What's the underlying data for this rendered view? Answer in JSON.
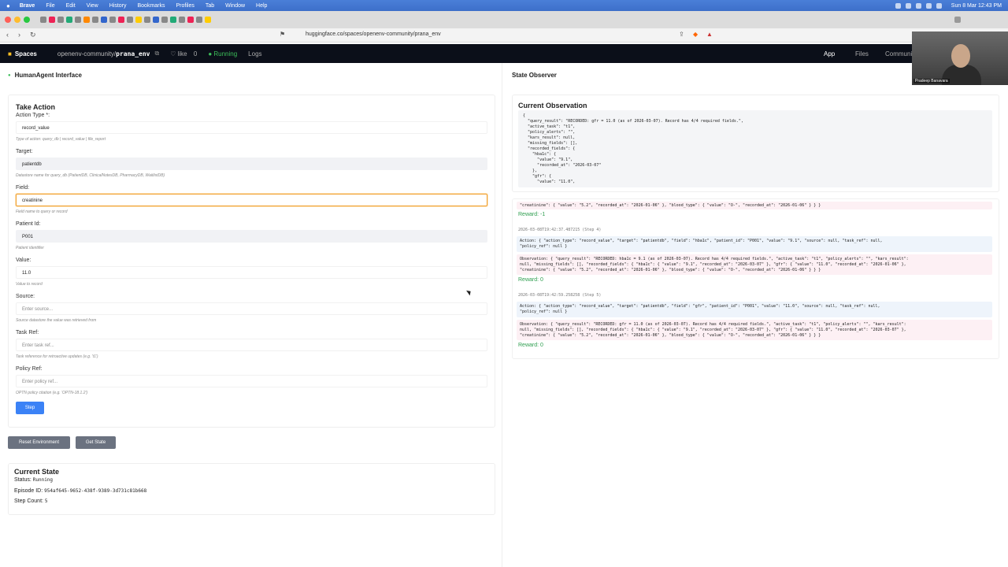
{
  "menubar": {
    "app": "Brave",
    "items": [
      "File",
      "Edit",
      "View",
      "History",
      "Bookmarks",
      "Profiles",
      "Tab",
      "Window",
      "Help"
    ],
    "clock": "Sun 8 Mar  12:43 PM"
  },
  "browser": {
    "url": "huggingface.co/spaces/openenv-community/prana_env"
  },
  "hf": {
    "spaces": "Spaces",
    "org": "openenv-community/",
    "repo": "prana_env",
    "like": "♡ like",
    "like_count": "0",
    "status": "● Running",
    "logs": "Logs",
    "tab_app": "App",
    "tab_files": "Files",
    "tab_community": "Communi"
  },
  "left": {
    "interface_title": "HumanAgent Interface",
    "take_action": "Take Action",
    "fields": {
      "action_type": {
        "label": "Action Type *:",
        "value": "record_value",
        "hint": "Type of action: query_db | record_value | file_report"
      },
      "target": {
        "label": "Target:",
        "value": "patientdb",
        "hint": "Datastore name for query_db (PatientDB, ClinicalNotesDB, PharmacyDB, WaitlistDB)"
      },
      "field": {
        "label": "Field:",
        "value": "creatinine",
        "hint": "Field name to query or record"
      },
      "patient_id": {
        "label": "Patient Id:",
        "value": "P001",
        "hint": "Patient identifier"
      },
      "value": {
        "label": "Value:",
        "value": "11.0",
        "hint": "Value to record"
      },
      "source": {
        "label": "Source:",
        "placeholder": "Enter source...",
        "hint": "Source datastore the value was retrieved from"
      },
      "task_ref": {
        "label": "Task Ref:",
        "placeholder": "Enter task ref...",
        "hint": "Task reference for retroactive updates (e.g. 't1')"
      },
      "policy_ref": {
        "label": "Policy Ref:",
        "placeholder": "Enter policy ref...",
        "hint": "OPTN policy citation (e.g. 'OPTN-18.1.2')"
      }
    },
    "step_button": "Step",
    "reset_button": "Reset Environment",
    "get_state_button": "Get State",
    "current_state": {
      "title": "Current State",
      "status_label": "Status:",
      "status_value": "Running",
      "episode_label": "Episode ID:",
      "episode_value": "954af645-9652-438f-9389-3d731c81b668",
      "step_label": "Step Count:",
      "step_value": "5"
    }
  },
  "right": {
    "title": "State Observer",
    "current_obs_title": "Current Observation",
    "observation_json": "{\n  \"query_result\": \"RECORDED: gfr = 11.0 (as of 2026-03-07). Record has 4/4 required fields.\",\n  \"active_task\": \"t1\",\n  \"policy_alerts\": \"\",\n  \"kars_result\": null,\n  \"missing_fields\": [],\n  \"recorded_fields\": {\n    \"hba1c\": {\n      \"value\": \"9.1\",\n      \"recorded_at\": \"2026-03-07\"\n    },\n    \"gfr\": {\n      \"value\": \"11.0\",",
    "log_top": "\"creatinine\": { \"value\": \"5.2\", \"recorded_at\": \"2026-01-06\" }, \"blood_type\": { \"value\": \"O-\", \"recorded_at\": \"2026-01-06\" } } }",
    "reward_1": "Reward: -1",
    "step4": {
      "timestamp": "2026-03-08T19:42:37.487215 (Step 4)",
      "action": "Action: { \"action_type\": \"record_value\", \"target\": \"patientdb\", \"field\": \"hba1c\", \"patient_id\": \"P001\", \"value\": \"9.1\", \"source\": null, \"task_ref\": null,\n\"policy_ref\": null }",
      "observation": "Observation: { \"query_result\": \"RECORDED: hba1c = 9.1 (as of 2026-03-07). Record has 4/4 required fields.\", \"active_task\": \"t1\", \"policy_alerts\": \"\", \"kars_result\":\nnull, \"missing_fields\": [], \"recorded_fields\": { \"hba1c\": { \"value\": \"9.1\", \"recorded_at\": \"2026-03-07\" }, \"gfr\": { \"value\": \"11.0\", \"recorded_at\": \"2026-01-06\" },\n\"creatinine\": { \"value\": \"5.2\", \"recorded_at\": \"2026-01-06\" }, \"blood_type\": { \"value\": \"O-\", \"recorded_at\": \"2026-01-06\" } } }",
      "reward": "Reward: 0"
    },
    "step5": {
      "timestamp": "2026-03-08T19:42:59.258258 (Step 5)",
      "action": "Action: { \"action_type\": \"record_value\", \"target\": \"patientdb\", \"field\": \"gfr\", \"patient_id\": \"P001\", \"value\": \"11.0\", \"source\": null, \"task_ref\": null,\n\"policy_ref\": null }",
      "observation": "Observation: { \"query_result\": \"RECORDED: gfr = 11.0 (as of 2026-03-07). Record has 4/4 required fields.\", \"active_task\": \"t1\", \"policy_alerts\": \"\", \"kars_result\":\nnull, \"missing_fields\": [], \"recorded_fields\": { \"hba1c\": { \"value\": \"9.1\", \"recorded_at\": \"2026-03-07\" }, \"gfr\": { \"value\": \"11.0\", \"recorded_at\": \"2026-03-07\" },\n\"creatinine\": { \"value\": \"5.2\", \"recorded_at\": \"2026-01-06\" }, \"blood_type\": { \"value\": \"O-\", \"recorded_at\": \"2026-01-06\" } } }",
      "reward": "Reward: 0"
    }
  },
  "webcam": {
    "name": "Pradeep Banavara"
  },
  "colors": {
    "accent_blue": "#3b82f6",
    "reward_green": "#2e9e4f",
    "running_green": "#3cbf5a",
    "focus_orange": "#f0a030"
  }
}
